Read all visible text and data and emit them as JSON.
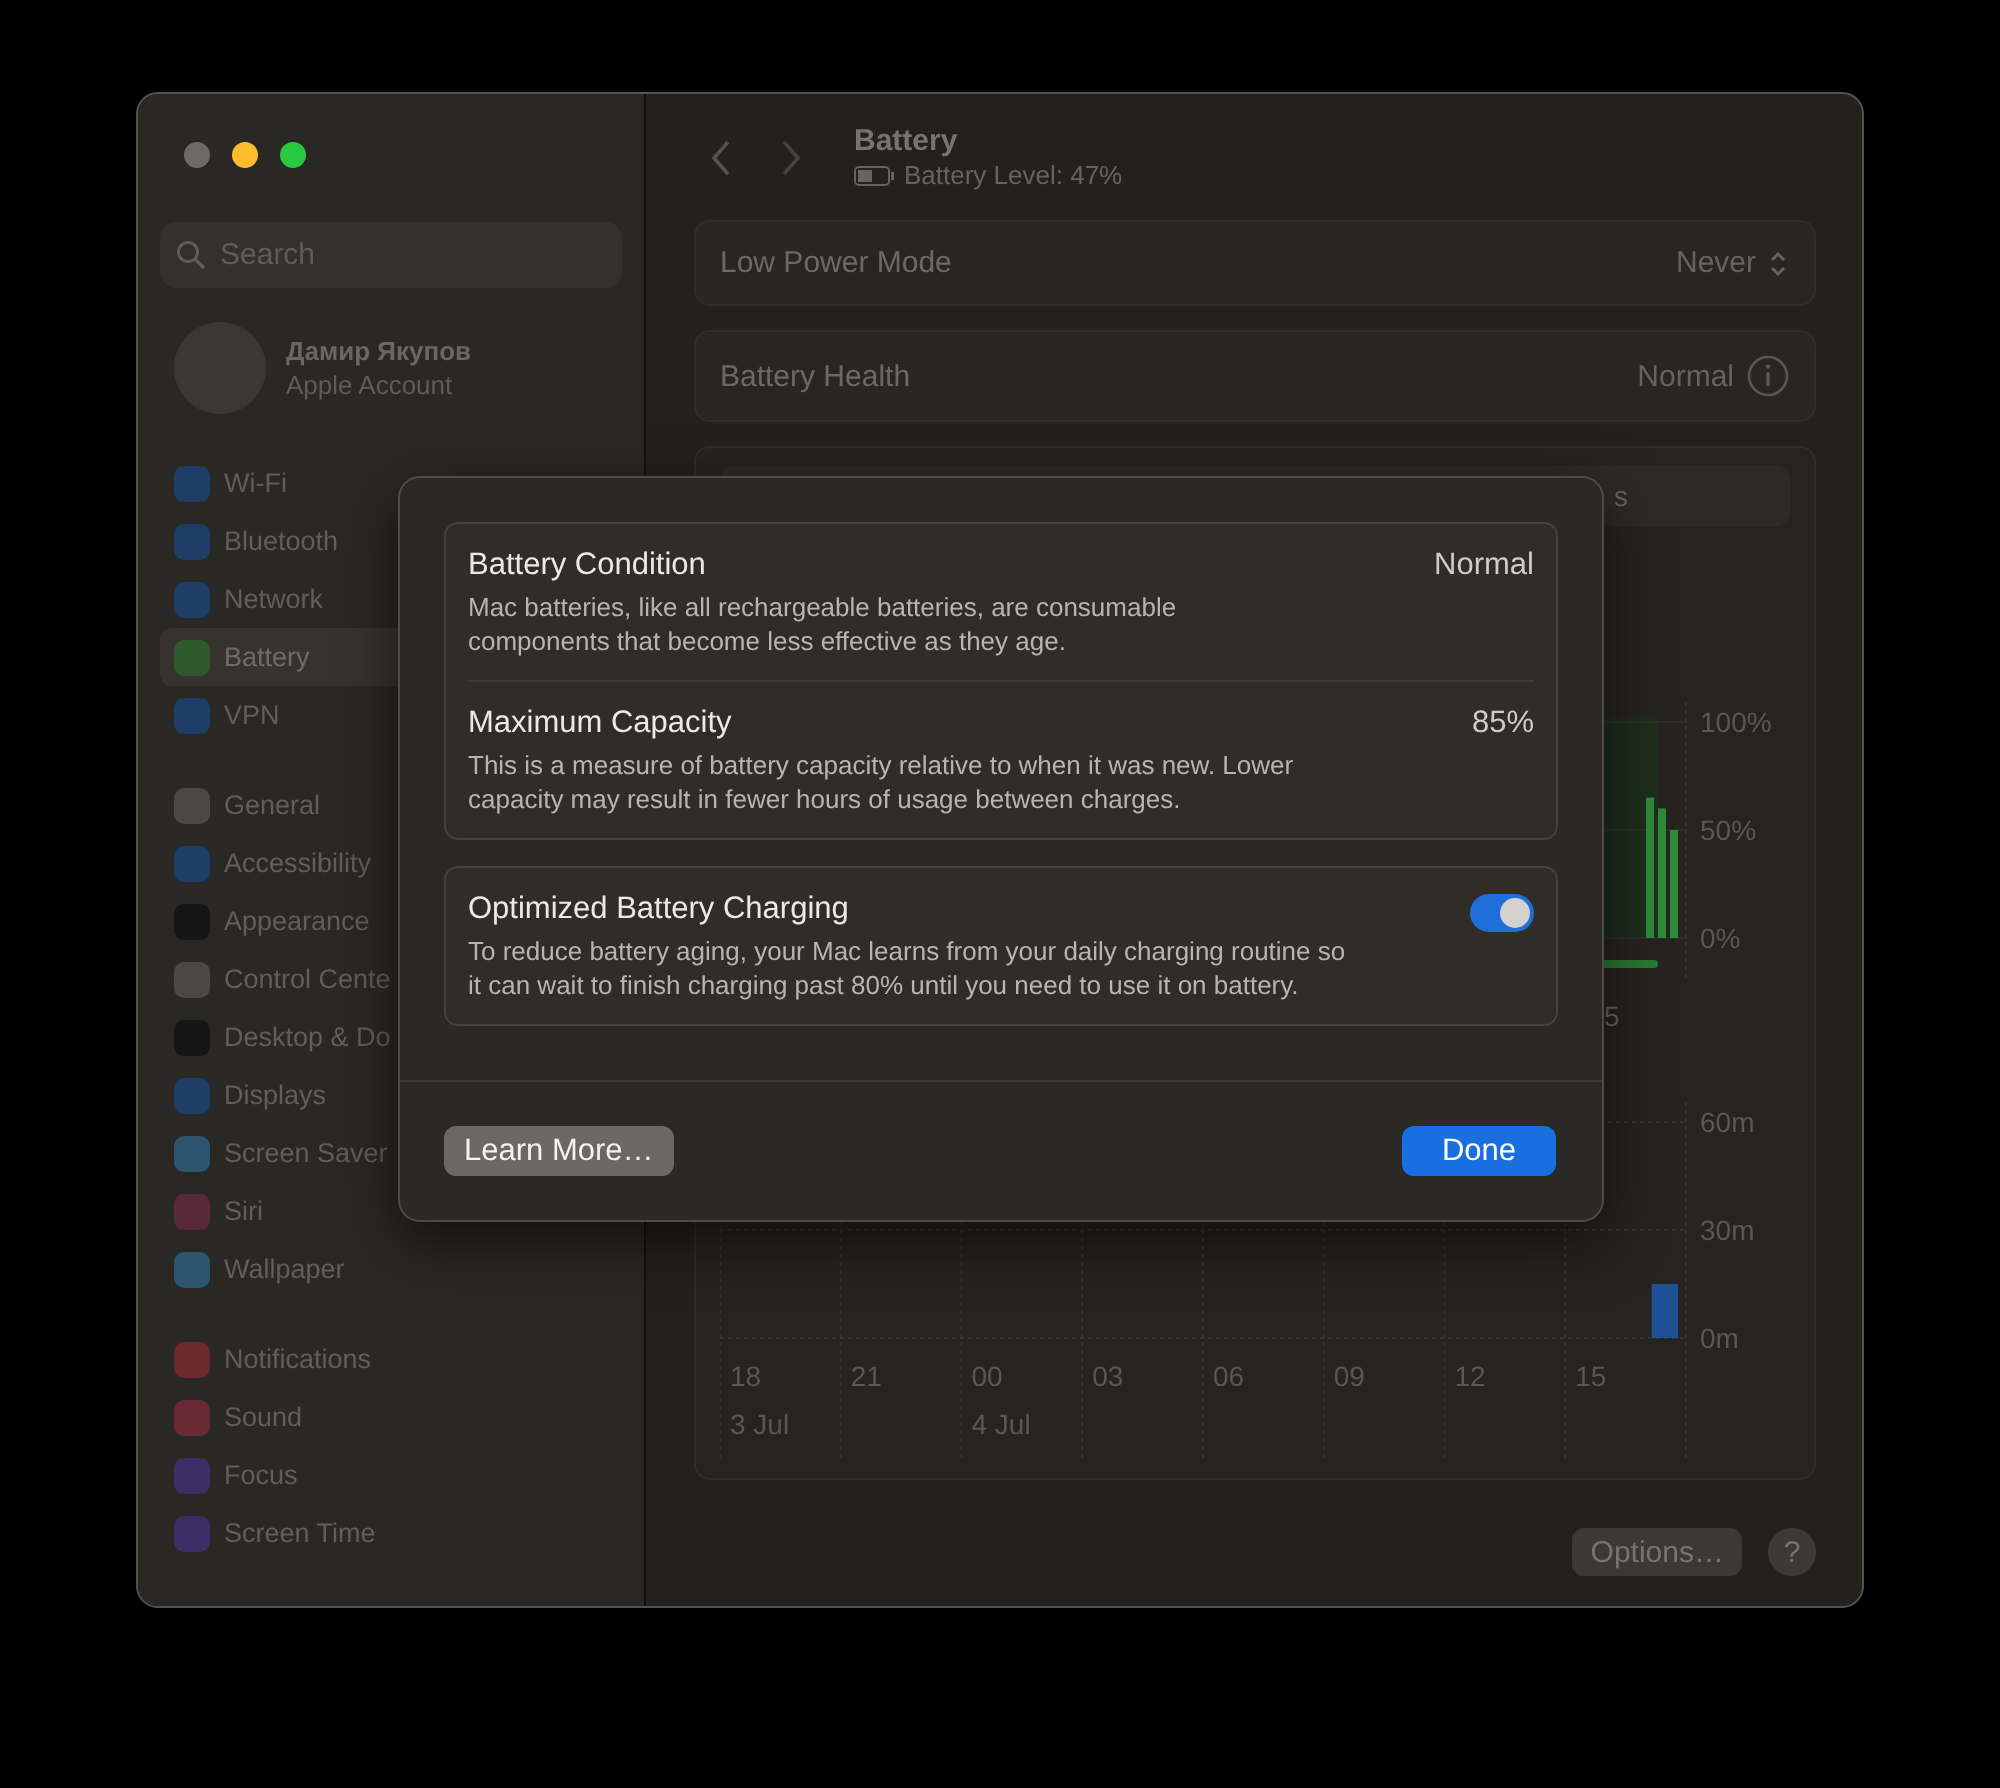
{
  "window": {
    "traffic_lights": [
      {
        "color": "#6b6a68"
      },
      {
        "color": "#febc2e"
      },
      {
        "color": "#28c840"
      }
    ]
  },
  "sidebar": {
    "search": {
      "placeholder": "Search"
    },
    "account": {
      "name": "Дамир Якупов",
      "subtitle": "Apple Account"
    },
    "groups": [
      {
        "items": [
          {
            "label": "Wi-Fi",
            "color": "#1d3e66",
            "selected": false
          },
          {
            "label": "Bluetooth",
            "color": "#1d3e66",
            "selected": false
          },
          {
            "label": "Network",
            "color": "#1d3e66",
            "selected": false
          },
          {
            "label": "Battery",
            "color": "#2e5a2a",
            "selected": true
          },
          {
            "label": "VPN",
            "color": "#1d3e66",
            "selected": false
          }
        ]
      },
      {
        "items": [
          {
            "label": "General",
            "color": "#4a4846",
            "selected": false
          },
          {
            "label": "Accessibility",
            "color": "#1d3e66",
            "selected": false
          },
          {
            "label": "Appearance",
            "color": "#161616",
            "selected": false
          },
          {
            "label": "Control Cente",
            "color": "#4a4846",
            "selected": false
          },
          {
            "label": "Desktop & Do",
            "color": "#161616",
            "selected": false
          },
          {
            "label": "Displays",
            "color": "#1d3e66",
            "selected": false
          },
          {
            "label": "Screen Saver",
            "color": "#2e5570",
            "selected": false
          },
          {
            "label": "Siri",
            "color": "#5a2a3a",
            "selected": false
          },
          {
            "label": "Wallpaper",
            "color": "#2e5570",
            "selected": false
          }
        ]
      },
      {
        "items": [
          {
            "label": "Notifications",
            "color": "#6a2a2a",
            "selected": false
          },
          {
            "label": "Sound",
            "color": "#6a2a34",
            "selected": false
          },
          {
            "label": "Focus",
            "color": "#3a2f66",
            "selected": false
          },
          {
            "label": "Screen Time",
            "color": "#3a2f66",
            "selected": false
          }
        ]
      }
    ]
  },
  "header": {
    "title": "Battery",
    "subtitle": "Battery Level: 47%"
  },
  "settings": [
    {
      "label": "Low Power Mode",
      "value": "Never",
      "kind": "popup"
    },
    {
      "label": "Battery Health",
      "value": "Normal",
      "kind": "info"
    }
  ],
  "usage_card": {
    "segment_label_partial": "s",
    "level_chart": {
      "partial_x_label": "5",
      "chart_data": {
        "type": "bar",
        "ylim": [
          0,
          100
        ],
        "yticks": [
          {
            "value": 100,
            "label": "100%"
          },
          {
            "value": 50,
            "label": "50%"
          },
          {
            "value": 0,
            "label": "0%"
          }
        ],
        "series": [
          {
            "color": "#2f8a3a",
            "values": [
              65,
              60,
              50
            ]
          }
        ]
      }
    },
    "screen_chart": {
      "date_labels": [
        "3 Jul",
        "4 Jul"
      ],
      "chart_data": {
        "type": "bar",
        "categories": [
          "18",
          null,
          null,
          "21",
          null,
          null,
          "00",
          null,
          null,
          "03",
          null,
          null,
          "06",
          null,
          null,
          "09",
          null,
          null,
          "12",
          null,
          null,
          "15",
          null,
          null
        ],
        "ylim": [
          0,
          60
        ],
        "yticks": [
          {
            "value": 60,
            "label": "60m"
          },
          {
            "value": 30,
            "label": "30m"
          },
          {
            "value": 0,
            "label": "0m"
          }
        ],
        "series": [
          {
            "color": "#1f4f95",
            "values": [
              null,
              null,
              null,
              null,
              null,
              null,
              null,
              null,
              null,
              null,
              null,
              null,
              null,
              null,
              null,
              null,
              null,
              null,
              null,
              null,
              null,
              null,
              null,
              15
            ]
          }
        ]
      }
    }
  },
  "footer_buttons": [
    {
      "label": "Options…",
      "kind": "text"
    },
    {
      "label": "?",
      "kind": "help"
    }
  ],
  "dialog": {
    "groups": [
      {
        "rows": [
          {
            "kind": "value",
            "title": "Battery Condition",
            "value": "Normal",
            "description": "Mac batteries, like all rechargeable batteries, are consumable components that become less effective as they age."
          },
          {
            "kind": "value",
            "title": "Maximum Capacity",
            "value": "85%",
            "description": "This is a measure of battery capacity relative to when it was new. Lower capacity may result in fewer hours of usage between charges."
          }
        ]
      },
      {
        "rows": [
          {
            "kind": "toggle",
            "title": "Optimized Battery Charging",
            "on": true,
            "description": "To reduce battery aging, your Mac learns from your daily charging routine so it can wait to finish charging past 80% until you need to use it on battery."
          }
        ]
      }
    ],
    "buttons": [
      {
        "label": "Learn More…",
        "kind": "secondary"
      },
      {
        "label": "Done",
        "kind": "primary"
      }
    ]
  }
}
